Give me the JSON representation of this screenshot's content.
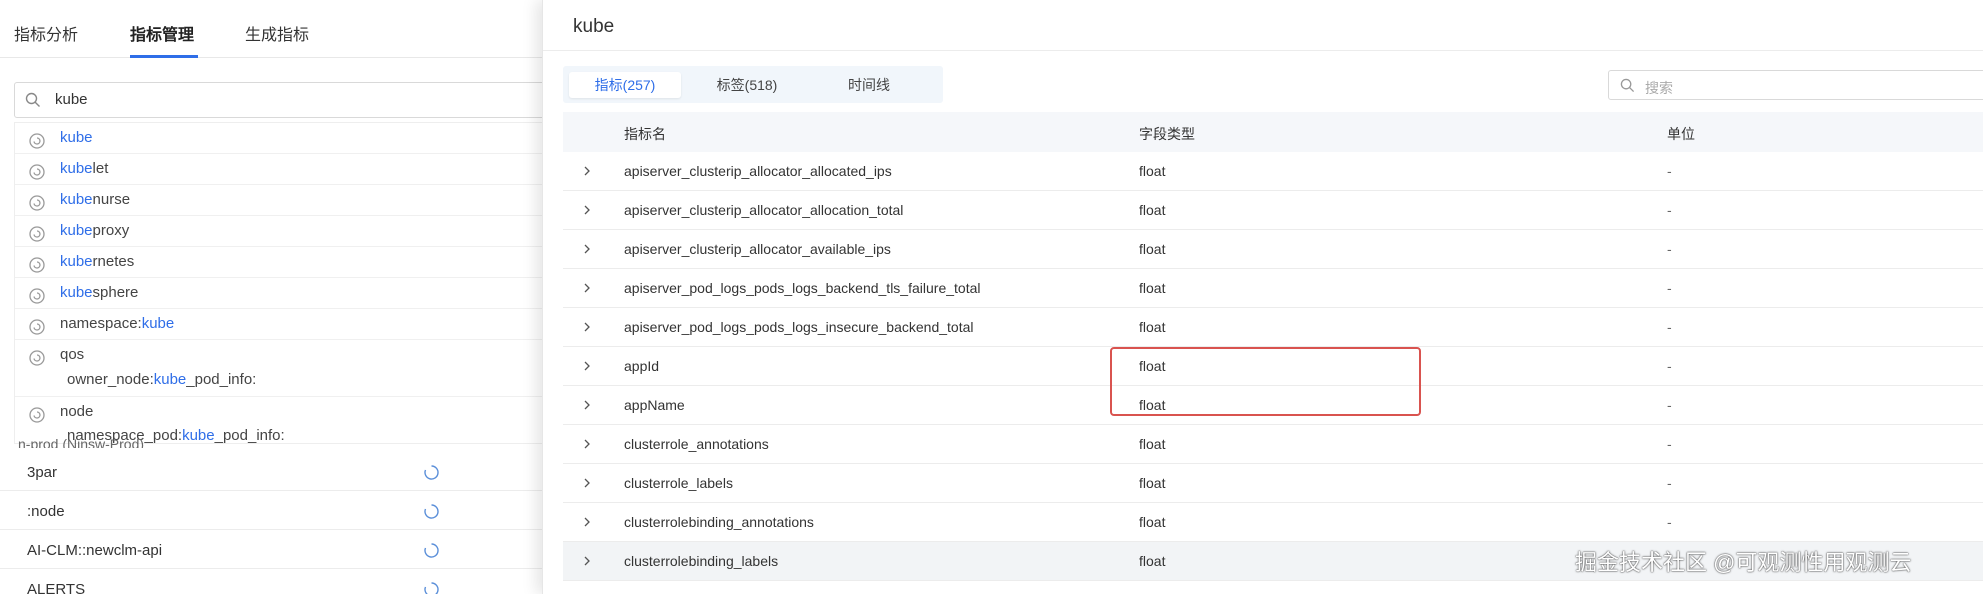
{
  "left_tabs": [
    {
      "label": "指标分析"
    },
    {
      "label": "指标管理"
    },
    {
      "label": "生成指标"
    }
  ],
  "search": {
    "value": "kube"
  },
  "suggestions": [
    {
      "highlight": "kube",
      "rest": ""
    },
    {
      "highlight": "kube",
      "rest": "let"
    },
    {
      "highlight": "kube",
      "rest": "nurse"
    },
    {
      "highlight": "kube",
      "rest": "proxy"
    },
    {
      "highlight": "kube",
      "rest": "rnetes"
    },
    {
      "highlight": "kube",
      "rest": "sphere"
    },
    {
      "prefix": "namespace:",
      "highlight": "kube",
      "rest": ""
    },
    {
      "text": "qos",
      "sub_prefix": "owner_node:",
      "sub_highlight": "kube",
      "sub_rest": "_pod_info:"
    },
    {
      "text": "node",
      "sub_prefix": "namespace_pod:",
      "sub_highlight": "kube",
      "sub_rest": "_pod_info:"
    }
  ],
  "partial_item": "n-prod (Ninsw-Prod)",
  "list_items": [
    "3par",
    ":node",
    "AI-CLM::newclm-api",
    "ALERTS"
  ],
  "drawer": {
    "title": "kube",
    "tabs": [
      {
        "label": "指标(257)"
      },
      {
        "label": "标签(518)"
      },
      {
        "label": "时间线"
      }
    ],
    "search_placeholder": "搜索",
    "columns": [
      "指标名",
      "字段类型",
      "单位"
    ],
    "rows": [
      {
        "name": "apiserver_clusterip_allocator_allocated_ips",
        "type": "float",
        "unit": "-"
      },
      {
        "name": "apiserver_clusterip_allocator_allocation_total",
        "type": "float",
        "unit": "-"
      },
      {
        "name": "apiserver_clusterip_allocator_available_ips",
        "type": "float",
        "unit": "-"
      },
      {
        "name": "apiserver_pod_logs_pods_logs_backend_tls_failure_total",
        "type": "float",
        "unit": "-"
      },
      {
        "name": "apiserver_pod_logs_pods_logs_insecure_backend_total",
        "type": "float",
        "unit": "-"
      },
      {
        "name": "appId",
        "type": "float",
        "unit": "-"
      },
      {
        "name": "appName",
        "type": "float",
        "unit": "-"
      },
      {
        "name": "clusterrole_annotations",
        "type": "float",
        "unit": "-"
      },
      {
        "name": "clusterrole_labels",
        "type": "float",
        "unit": "-"
      },
      {
        "name": "clusterrolebinding_annotations",
        "type": "float",
        "unit": "-"
      },
      {
        "name": "clusterrolebinding_labels",
        "type": "float",
        "unit": "-"
      }
    ]
  },
  "watermark": "掘金技术社区 @可观测性用观测云",
  "colors": {
    "accent": "#2f6ee8",
    "highlight_box": "#d9534f"
  }
}
